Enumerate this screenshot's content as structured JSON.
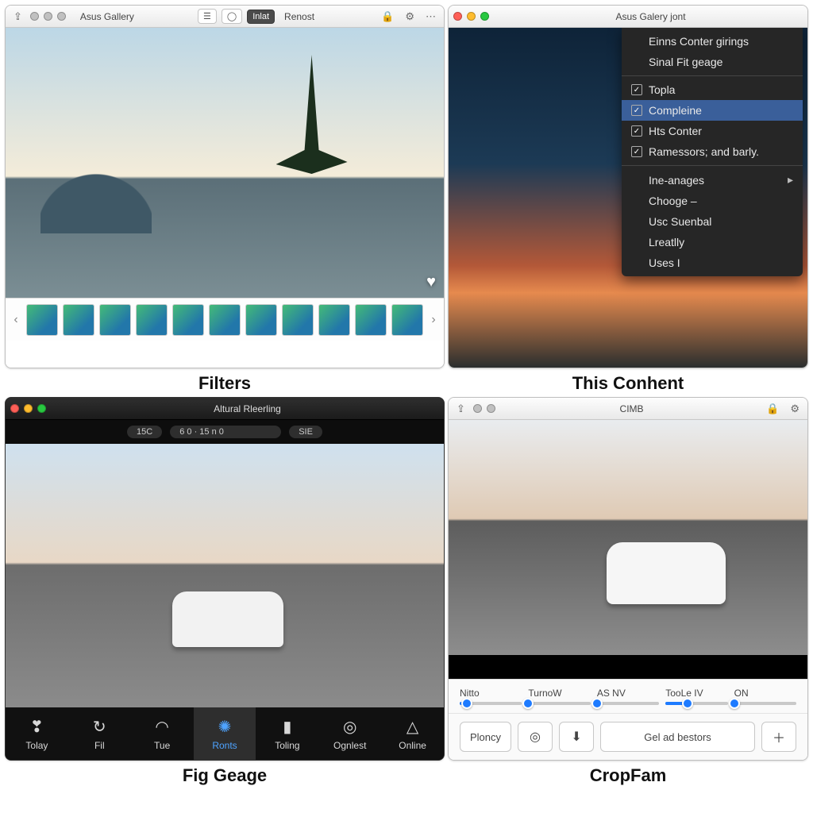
{
  "panel1": {
    "caption": "Filters",
    "title": "Asus Gallery",
    "toolbar": {
      "btn1": "Inlat",
      "btn2": "Renost"
    },
    "heart_icon": "♥",
    "thumbs_count": 11
  },
  "panel2": {
    "caption": "This Conhent",
    "title": "Asus Galery jont",
    "menu": [
      {
        "label": "Einns Conter girings",
        "kind": "plain"
      },
      {
        "label": "Sinal Fit geage",
        "kind": "plain"
      },
      {
        "label": "Topla",
        "kind": "check",
        "checked": true
      },
      {
        "label": "Compleine",
        "kind": "check",
        "checked": true,
        "selected": true
      },
      {
        "label": "Hts Conter",
        "kind": "check",
        "checked": true
      },
      {
        "label": "Ramessors; and barly.",
        "kind": "check",
        "checked": true
      },
      {
        "label": "Ine-anages",
        "kind": "submenu"
      },
      {
        "label": "Chooge –",
        "kind": "plain"
      },
      {
        "label": "Usc Suenbal",
        "kind": "plain"
      },
      {
        "label": "Lreatlly",
        "kind": "plain"
      },
      {
        "label": "Uses I",
        "kind": "plain"
      }
    ]
  },
  "panel3": {
    "caption": "Fig Geage",
    "title": "Altural Rleerling",
    "top_left": "15C",
    "top_readout": "6 0 · 15 n      0",
    "top_right": "SIE",
    "tabs": [
      {
        "label": "Tolay",
        "icon": "❣"
      },
      {
        "label": "Fil",
        "icon": "↻"
      },
      {
        "label": "Tue",
        "icon": "◠"
      },
      {
        "label": "Ronts",
        "icon": "✺",
        "active": true
      },
      {
        "label": "Toling",
        "icon": "▮"
      },
      {
        "label": "Ognlest",
        "icon": "◎"
      },
      {
        "label": "Online",
        "icon": "△"
      }
    ]
  },
  "panel4": {
    "caption": "CropFam",
    "title": "CIMB",
    "sliders": [
      {
        "label": "Nitto",
        "value": 12
      },
      {
        "label": "TurnoW",
        "value": 0
      },
      {
        "label": "AS NV",
        "value": 0
      },
      {
        "label": "TooLe IV",
        "value": 35
      },
      {
        "label": "ON",
        "value": 0
      }
    ],
    "buttons": {
      "left": "Ploncy",
      "mid1_icon": "dial-icon",
      "mid2_icon": "download-icon",
      "wide": "Gel ad bestors",
      "plus_icon": "plus-icon"
    }
  }
}
